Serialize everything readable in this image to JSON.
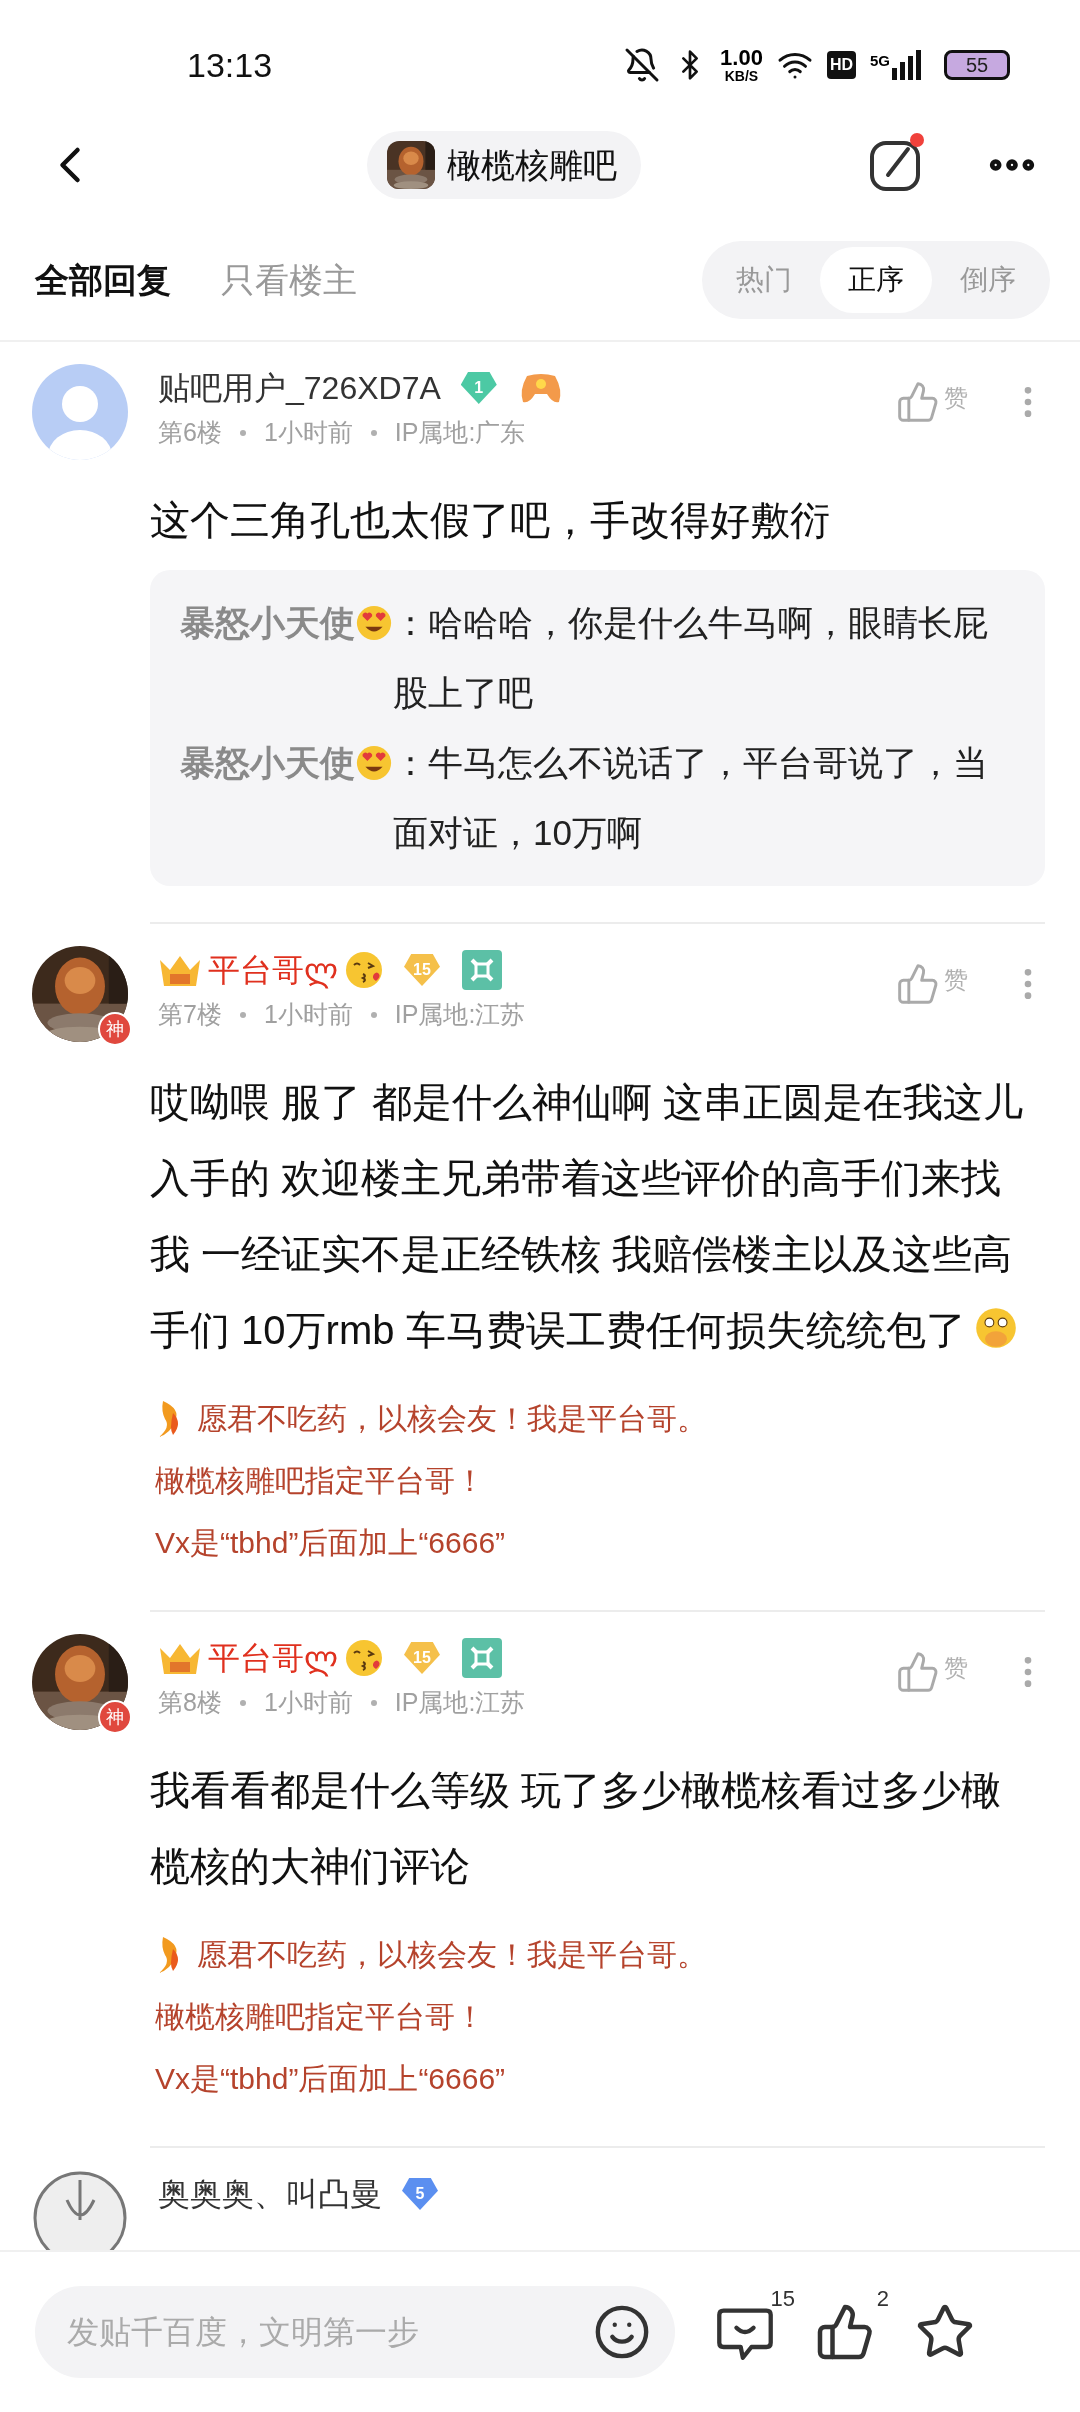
{
  "status_bar": {
    "time": "13:13",
    "speed_value": "1.00",
    "speed_unit": "KB/S",
    "hd": "HD",
    "network": "5G",
    "battery": "55"
  },
  "header": {
    "forum_name": "橄榄核雕吧",
    "compose_unread": true
  },
  "filter_tabs": [
    {
      "label": "全部回复",
      "selected": true
    },
    {
      "label": "只看楼主",
      "selected": false
    }
  ],
  "sort_tabs": [
    {
      "label": "热门",
      "selected": false
    },
    {
      "label": "正序",
      "selected": true
    },
    {
      "label": "倒序",
      "selected": false
    }
  ],
  "posts": [
    {
      "kind": "guest",
      "author": "贴吧用户_726XD7A",
      "level": "1",
      "color": "#4cc9a4",
      "floor": "第6楼",
      "time": "1小时前",
      "ip": "IP属地:广东",
      "like_label": "赞",
      "body": "这个三角孔也太假了吧，手改得好敷衍",
      "body_emoji": false,
      "quotes": [
        {
          "author": "暴怒小天使",
          "text": "：哈哈哈，你是什么牛马啊，眼睛长屁股上了吧"
        },
        {
          "author": "暴怒小天使",
          "text": "：牛马怎么不说话了，平台哥说了，当面对证，10万啊"
        }
      ]
    },
    {
      "kind": "vip",
      "avatar_badge": "神",
      "author": "平台哥ლ",
      "level": "15",
      "color": "#f5c04a",
      "floor": "第7楼",
      "time": "1小时前",
      "ip": "IP属地:江苏",
      "like_label": "赞",
      "body": "哎呦喂 服了 都是什么神仙啊 这串正圆是在我这儿入手的 欢迎楼主兄弟带着这些评价的高手们来找我 一经证实不是正经铁核 我赔偿楼主以及这些高手们 10万rmb 车马费误工费任何损失统统包了",
      "body_emoji": true,
      "signature": [
        "愿君不吃药，以核会友！我是平台哥。",
        "橄榄核雕吧指定平台哥！",
        "Vx是“tbhd”后面加上“6666”"
      ]
    },
    {
      "kind": "vip",
      "avatar_badge": "神",
      "author": "平台哥ლ",
      "level": "15",
      "color": "#f5c04a",
      "floor": "第8楼",
      "time": "1小时前",
      "ip": "IP属地:江苏",
      "like_label": "赞",
      "body": "我看看都是什么等级 玩了多少橄榄核看过多少橄榄核的大神们评论",
      "body_emoji": false,
      "signature": [
        "愿君不吃药，以核会友！我是平台哥。",
        "橄榄核雕吧指定平台哥！",
        "Vx是“tbhd”后面加上“6666”"
      ]
    },
    {
      "kind": "member",
      "author": "奥奥奥、叫凸曼",
      "level": "5",
      "color": "#5b8ff0"
    }
  ],
  "bottom_bar": {
    "placeholder": "发贴千百度，文明第一步",
    "comment_count": "15",
    "like_count": "2"
  }
}
